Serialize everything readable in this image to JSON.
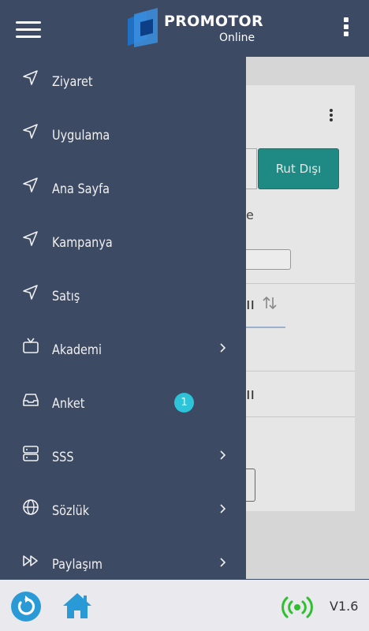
{
  "header": {
    "brand_title": "PROMOTOR",
    "brand_subtitle": "Online",
    "menu_icon": "hamburger-icon",
    "more_icon": "kebab-icon"
  },
  "drawer": {
    "items": [
      {
        "label": "Ziyaret",
        "icon": "navigation-arrow-icon",
        "has_chevron": false
      },
      {
        "label": "Uygulama",
        "icon": "navigation-arrow-icon",
        "has_chevron": false
      },
      {
        "label": "Ana Sayfa",
        "icon": "navigation-arrow-icon",
        "has_chevron": false
      },
      {
        "label": "Kampanya",
        "icon": "navigation-arrow-icon",
        "has_chevron": false
      },
      {
        "label": "Satış",
        "icon": "navigation-arrow-icon",
        "has_chevron": false
      },
      {
        "label": "Akademi",
        "icon": "tv-icon",
        "has_chevron": true
      },
      {
        "label": "Anket",
        "icon": "inbox-icon",
        "has_chevron": false,
        "badge": "1"
      },
      {
        "label": "SSS",
        "icon": "server-icon",
        "has_chevron": true
      },
      {
        "label": "Sözlük",
        "icon": "globe-icon",
        "has_chevron": true
      },
      {
        "label": "Paylaşım",
        "icon": "fast-forward-icon",
        "has_chevron": true
      }
    ]
  },
  "background": {
    "button_label": "Rut Dışı",
    "fragment_e": "e",
    "fragment_row1": "ıı",
    "fragment_row2": "ıı"
  },
  "footer": {
    "version": "V1.6",
    "refresh_icon": "refresh-icon",
    "home_icon": "home-icon",
    "signal_icon": "signal-icon"
  },
  "colors": {
    "header_bg": "#3d4a64",
    "drawer_bg": "#3d4a64",
    "accent_teal": "#1f8a83",
    "badge": "#2dc3d8",
    "signal_green": "#2fbf2f",
    "home_blue": "#2a9ad6"
  }
}
